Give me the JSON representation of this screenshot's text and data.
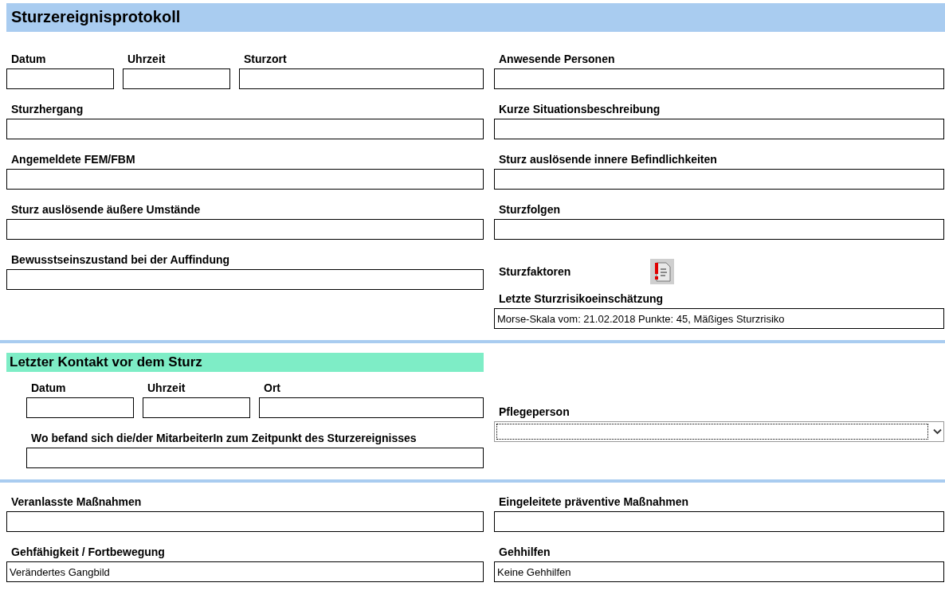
{
  "title": "Sturzereignisprotokoll",
  "sections": [
    {
      "left": [
        {
          "kind": "fields",
          "fields": [
            {
              "label": "Datum",
              "kind": "input"
            },
            {
              "label": "Uhrzeit",
              "kind": "input"
            },
            {
              "label": "Sturzort",
              "kind": "input"
            }
          ]
        },
        {
          "kind": "fields",
          "fields": [
            {
              "label": "Sturzhergang",
              "kind": "input"
            }
          ]
        },
        {
          "kind": "fields",
          "fields": [
            {
              "label": "Angemeldete FEM/FBM",
              "kind": "input"
            }
          ]
        },
        {
          "kind": "fields",
          "fields": [
            {
              "label": "Sturz auslösende äußere Umstände",
              "kind": "input"
            }
          ]
        },
        {
          "kind": "fields",
          "fields": [
            {
              "label": "Bewusstseinszustand bei der Auffindung",
              "kind": "input"
            }
          ]
        }
      ],
      "right": [
        {
          "kind": "fields",
          "fields": [
            {
              "label": "Anwesende Personen",
              "kind": "input"
            }
          ]
        },
        {
          "kind": "fields",
          "fields": [
            {
              "label": "Kurze Situationsbeschreibung",
              "kind": "input"
            }
          ]
        },
        {
          "kind": "fields",
          "fields": [
            {
              "label": "Sturz auslösende innere Befindlichkeiten",
              "kind": "input"
            }
          ]
        },
        {
          "kind": "fields",
          "fields": [
            {
              "label": "Sturzfolgen",
              "kind": "input"
            }
          ]
        },
        {
          "kind": "flag",
          "label": "Sturzfaktoren"
        },
        {
          "kind": "fields",
          "fields": [
            {
              "label": "Letzte Sturzrisikoeinschätzung",
              "kind": "input",
              "value": "Morse-Skala vom: 21.02.2018 Punkte: 45, Mäßiges Sturzrisiko"
            }
          ]
        }
      ]
    },
    {
      "heading": "Letzter Kontakt vor dem Sturz",
      "left": [
        {
          "kind": "fields",
          "fields": [
            {
              "label": "Datum",
              "kind": "input"
            },
            {
              "label": "Uhrzeit",
              "kind": "input"
            },
            {
              "label": "Ort",
              "kind": "input"
            }
          ]
        },
        {
          "kind": "fields",
          "fields": [
            {
              "label": "Wo befand sich die/der MitarbeiterIn zum Zeitpunkt des Sturzereignisses",
              "kind": "input"
            }
          ]
        }
      ],
      "right": [
        {
          "kind": "fields",
          "fields": [
            {
              "label": "Pflegeperson",
              "kind": "select"
            }
          ]
        }
      ]
    },
    {
      "left": [
        {
          "kind": "fields",
          "fields": [
            {
              "label": "Veranlasste Maßnahmen",
              "kind": "input"
            }
          ]
        },
        {
          "kind": "fields",
          "fields": [
            {
              "label": "Gehfähigkeit / Fortbewegung",
              "kind": "input",
              "value": "Verändertes Gangbild"
            }
          ]
        }
      ],
      "right": [
        {
          "kind": "fields",
          "fields": [
            {
              "label": "Eingeleitete präventive Maßnahmen",
              "kind": "input"
            }
          ]
        },
        {
          "kind": "fields",
          "fields": [
            {
              "label": "Gehhilfen",
              "kind": "input",
              "value": "Keine Gehhilfen"
            }
          ]
        }
      ]
    }
  ]
}
